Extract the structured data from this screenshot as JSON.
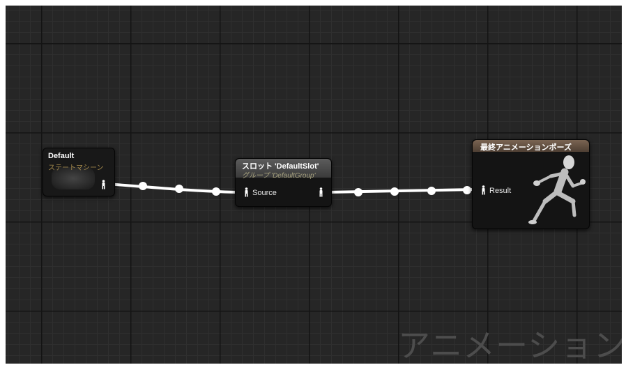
{
  "graph": {
    "watermark": "アニメーション"
  },
  "nodes": {
    "default": {
      "title": "Default",
      "subtitle": "ステートマシーン"
    },
    "slot": {
      "title": "スロット 'DefaultSlot'",
      "subtitle": "グループ 'DefaultGroup'",
      "input_label": "Source"
    },
    "final": {
      "title": "最終アニメーションポーズ",
      "input_label": "Result"
    }
  },
  "colors": {
    "background": "#262626",
    "wire": "#ffffff",
    "slot_subtitle": "#a7a27f",
    "default_subtitle": "#a58a4c",
    "final_header": "#6b5746"
  },
  "icons": {
    "pose_pin": "person-pin-icon",
    "preview": "running-mannequin-icon"
  }
}
